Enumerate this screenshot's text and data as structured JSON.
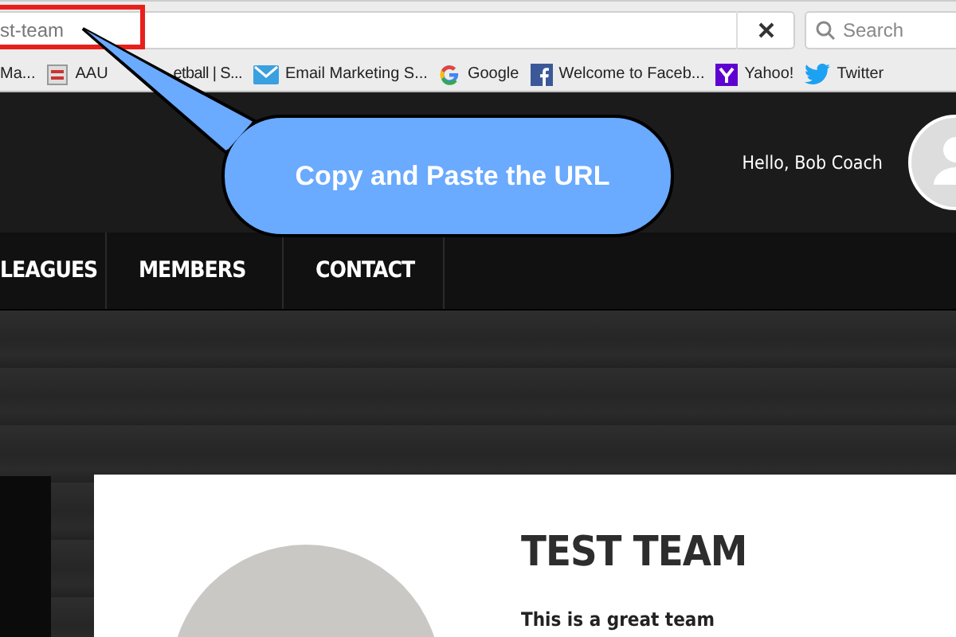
{
  "browser": {
    "url": "st-team",
    "search": {
      "placeholder": "Search"
    },
    "bookmarks": [
      {
        "label": "Ma...",
        "kind": "none"
      },
      {
        "label": "AAU",
        "label_end": "etball | S...",
        "kind": "site"
      },
      {
        "label": "Email Marketing S...",
        "kind": "mail"
      },
      {
        "label": "Google",
        "kind": "google"
      },
      {
        "label": "Welcome to Faceb...",
        "kind": "facebook"
      },
      {
        "label": "Yahoo!",
        "kind": "yahoo"
      },
      {
        "label": "Twitter",
        "kind": "twitter"
      }
    ]
  },
  "callout": {
    "text": "Copy and Paste the URL"
  },
  "header": {
    "greeting": "Hello, Bob Coach"
  },
  "nav": [
    {
      "label": "LEAGUES"
    },
    {
      "label": "MEMBERS"
    },
    {
      "label": "CONTACT"
    }
  ],
  "team": {
    "title": "TEST TEAM",
    "description": "This is a great team"
  }
}
